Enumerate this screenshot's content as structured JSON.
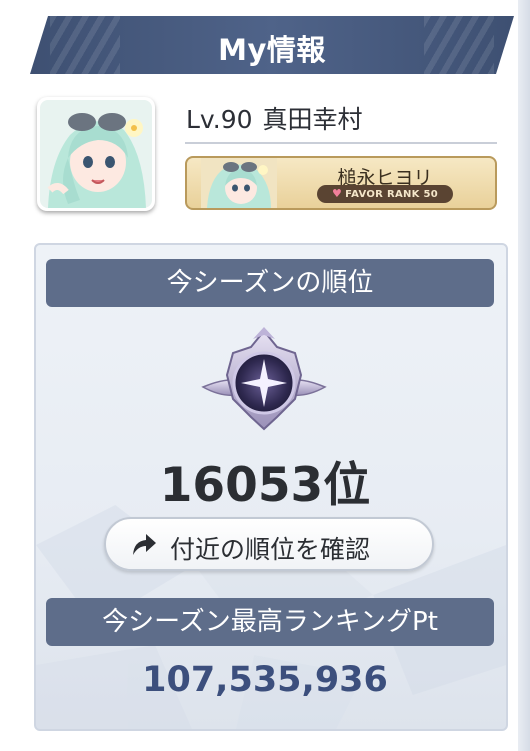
{
  "header": {
    "title": "My情報"
  },
  "player": {
    "level": "Lv.90",
    "name": "真田幸村"
  },
  "favor": {
    "character_name": "槌永ヒヨリ",
    "rank_label": "FAVOR RANK 50"
  },
  "season": {
    "rank_title": "今シーズンの順位",
    "rank_value": "16053位",
    "nearby_button_label": "付近の順位を確認",
    "best_title": "今シーズン最高ランキングPt",
    "best_value": "107,535,936"
  },
  "icons": {
    "player_avatar": "character-portrait",
    "favor_thumb": "character-portrait",
    "rank_emblem": "rank-emblem-icon",
    "nearby_icon": "share-arrow-icon",
    "favor_heart": "heart-icon"
  },
  "colors": {
    "header_bg": "#44577a",
    "section_bar_bg": "#5e6d8a",
    "best_value_text": "#3c4f7d",
    "favor_card_bg": "#eedaa8"
  }
}
